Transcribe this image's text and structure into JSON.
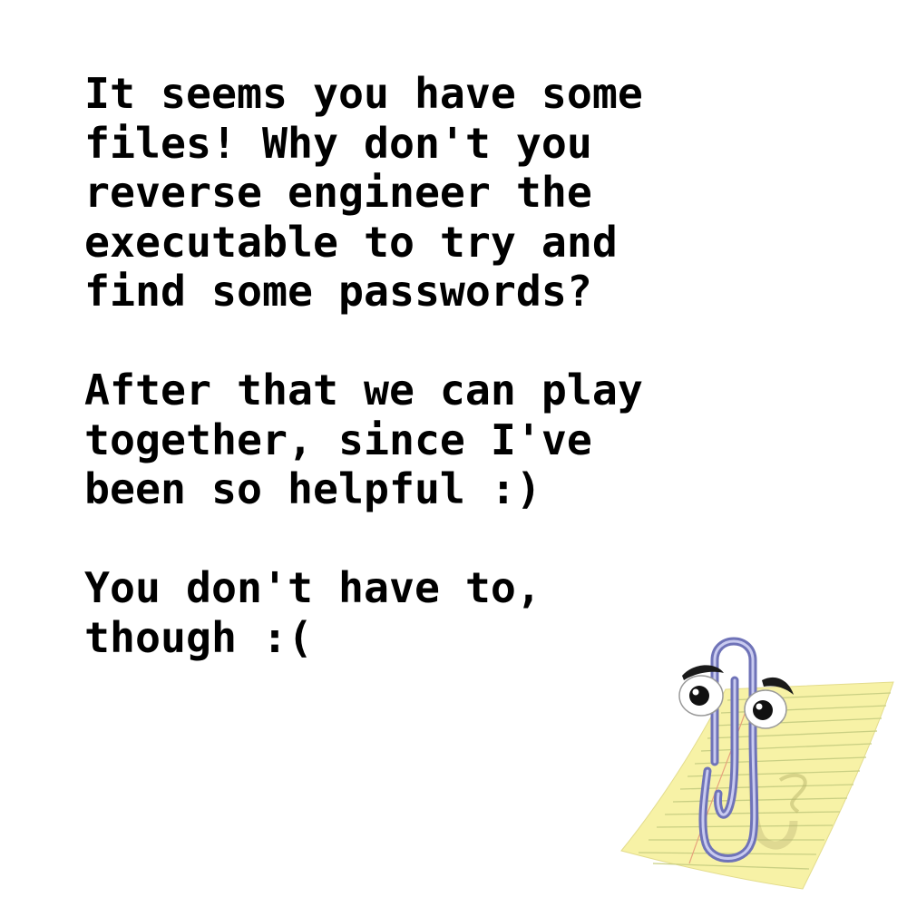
{
  "message": {
    "paragraphs": [
      {
        "lines": [
          "It seems you have some",
          "files! Why don't you",
          "reverse engineer the",
          "executable to try and",
          "find some passwords?"
        ]
      },
      {
        "lines": [
          "After that we can play",
          "together, since I've",
          "been so helpful :)"
        ]
      },
      {
        "lines": [
          "You don't have to,",
          "though :("
        ]
      }
    ]
  },
  "assistant": {
    "icon": "paperclip-assistant-icon",
    "colors": {
      "paper": "#f7f2a6",
      "paper_lines": "#c9cf83",
      "clip": "#6f73b8",
      "clip_highlight": "#c9cbf0"
    }
  }
}
